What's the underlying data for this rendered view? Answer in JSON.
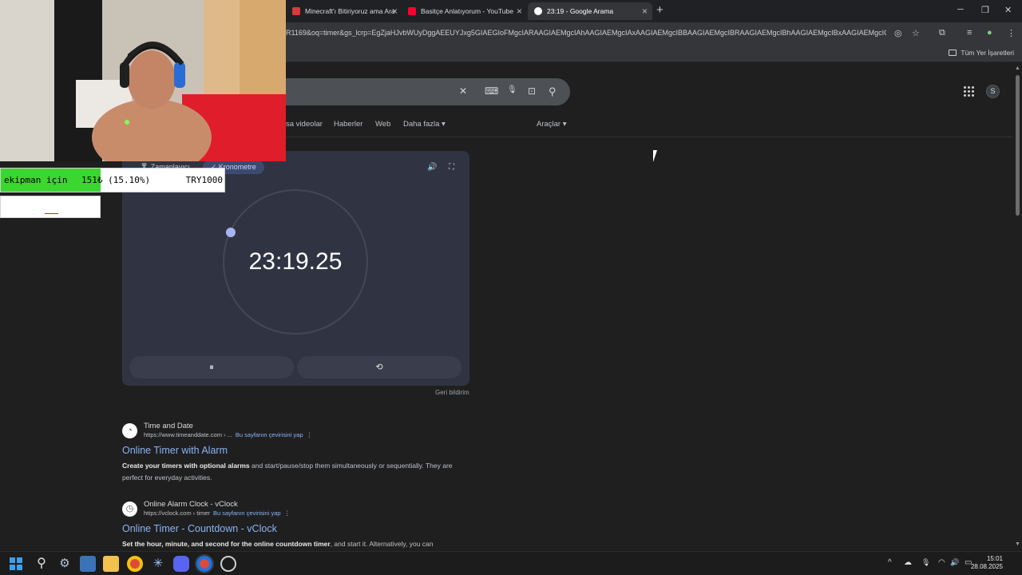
{
  "browser": {
    "tabs": [
      {
        "title": "Minecraft'ı Bitiriyoruz ama Ara",
        "active": false,
        "favicon_color": "#d83b3b"
      },
      {
        "title": "Basitçe Anlatıyorum - YouTube",
        "active": false,
        "favicon_color": "#ff0033"
      },
      {
        "title": "23:19 - Google Arama",
        "active": true,
        "favicon_color": "#ffffff"
      }
    ],
    "new_tab_label": "+",
    "window_controls": {
      "minimize": "─",
      "restore": "❐",
      "close": "✕"
    },
    "url": "R1169&oq=timer&gs_lcrp=EgZjaHJvbWUyDggAEEUYJxg5GIAEGIoFMgcIARAAGIAEMgcIAhAAGIAEMgcIAxAAGIAEMgcIBBAAGIAEMgcIBRAAGIAEMgcIBhAAGIAEMgcIBxAAGIAEMgcIC...",
    "bookmarks_all": "Tüm Yer İşaretleri"
  },
  "search": {
    "clear_icon": "✕",
    "keyboard_icon": "⌨",
    "mic_icon": "🎙",
    "lens_icon": "⊡",
    "search_icon": "⚲",
    "nav_tabs": [
      "sa videolar",
      "Haberler",
      "Web",
      "Daha fazla ▾"
    ],
    "tools": "Araçlar ▾"
  },
  "timer_widget": {
    "chips": [
      {
        "label": "⌛ Zamanlayıcı",
        "selected": false
      },
      {
        "label": "✓ Kronometre",
        "selected": true
      }
    ],
    "sound_icon": "🔊",
    "fullscreen_icon": "⛶",
    "time": "23:19.25",
    "pause_label": "⏸",
    "reset_label": "⟲",
    "feedback": "Geri bildirim"
  },
  "results": [
    {
      "site": "Time and Date",
      "url": "https://www.timeanddate.com › ...",
      "translate": "Bu sayfanın çevirisini yap",
      "title": "Online Timer with Alarm",
      "snippet_bold": "Create your timers with optional alarms",
      "snippet_rest": " and start/pause/stop them simultaneously or sequentially. They are perfect for everyday activities.",
      "icon": "◔"
    },
    {
      "site": "Online Alarm Clock - vClock",
      "url": "https://vclock.com › timer",
      "translate": "Bu sayfanın çevirisini yap",
      "title": "Online Timer - Countdown - vClock",
      "snippet_bold": "Set the hour, minute, and second for the online countdown timer",
      "snippet_rest": ", and start it. Alternatively, you can",
      "icon": "◷"
    }
  ],
  "donation_bar": {
    "label": "ekipman için",
    "progress_text": "151₺ (15.10%)",
    "progress_fraction": 0.151,
    "goal": "TRY1000",
    "fill_color": "#3bd630"
  },
  "taskbar": {
    "apps": [
      "windows-start",
      "search",
      "settings",
      "terminal",
      "file-explorer",
      "chrome",
      "network-app",
      "discord",
      "chrome-active",
      "obs"
    ],
    "tray": {
      "chevron": "^",
      "cloud": "☁",
      "mic": "🎙",
      "wifi": "◠",
      "volume": "🔊",
      "battery": "▭"
    },
    "time": "15:01",
    "date": "28.08.2025"
  }
}
